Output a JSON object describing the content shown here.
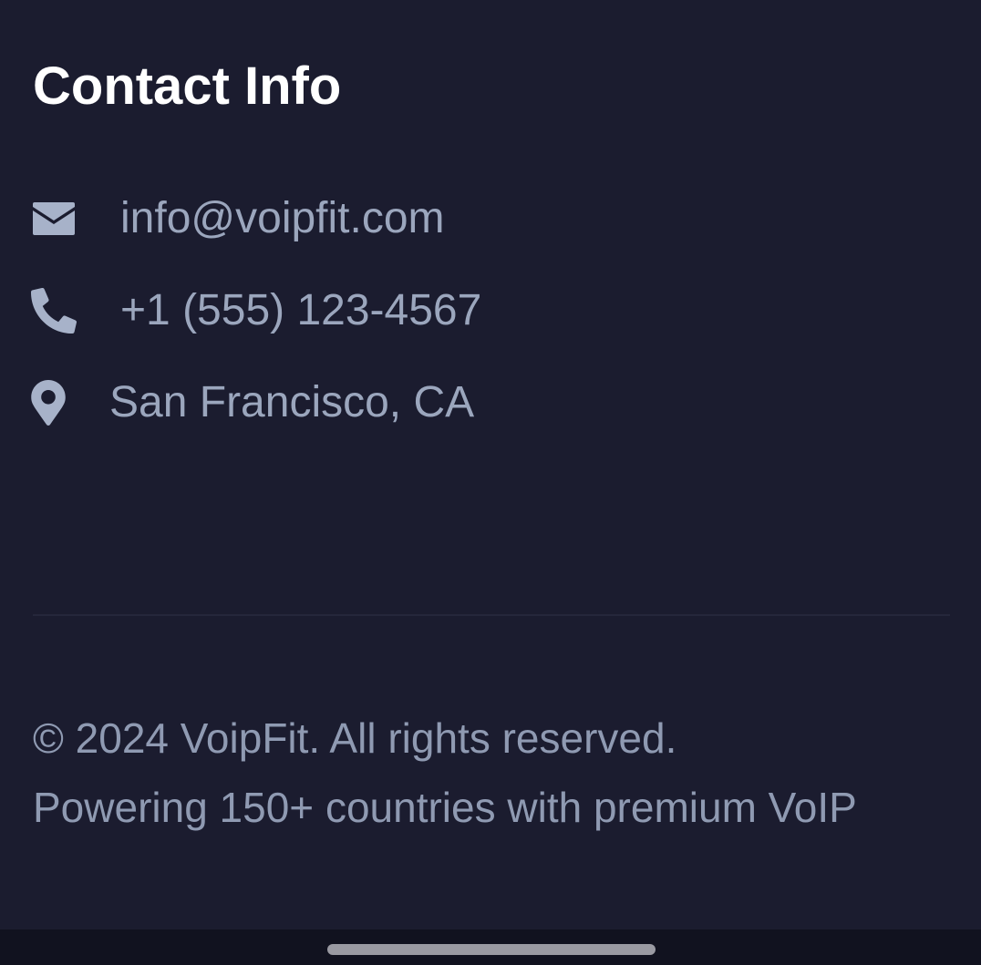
{
  "contact": {
    "title": "Contact Info",
    "email": {
      "icon": "envelope-icon",
      "text": "info@voipfit.com"
    },
    "phone": {
      "icon": "phone-icon",
      "text": "+1 (555) 123-4567"
    },
    "location": {
      "icon": "map-pin-icon",
      "text": "San Francisco, CA"
    }
  },
  "footer": {
    "copyright": "© 2024 VoipFit. All rights reserved.",
    "tagline": "Powering 150+ countries with premium VoIP"
  },
  "colors": {
    "background": "#1b1c2f",
    "heading": "#ffffff",
    "text_muted": "#9ba6bd",
    "icon": "#a7b2c9",
    "divider": "#25273b"
  }
}
